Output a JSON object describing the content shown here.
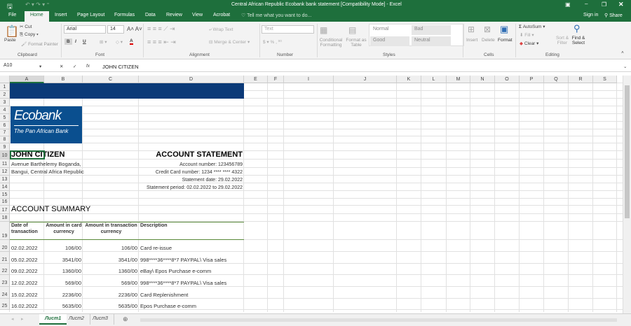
{
  "window": {
    "title": "Central African Republic Ecobank bank statement  [Compatibility Mode] - Excel",
    "sign_in": "Sign in",
    "share": "Share"
  },
  "ribbon_tabs": [
    "File",
    "Home",
    "Insert",
    "Page Layout",
    "Formulas",
    "Data",
    "Review",
    "View",
    "Acrobat"
  ],
  "tell_me": "Tell me what you want to do...",
  "ribbon": {
    "clipboard": {
      "paste": "Paste",
      "cut": "Cut",
      "copy": "Copy",
      "format_painter": "Format Painter",
      "group": "Clipboard"
    },
    "font": {
      "name": "Arial",
      "size": "14",
      "bold": "B",
      "italic": "I",
      "underline": "U",
      "group": "Font"
    },
    "alignment": {
      "wrap": "Wrap Text",
      "merge": "Merge & Center",
      "group": "Alignment"
    },
    "number": {
      "format": "Text",
      "group": "Number"
    },
    "styles": {
      "conditional": "Conditional Formatting",
      "format_table": "Format as Table",
      "normal": "Normal",
      "bad": "Bad",
      "good": "Good",
      "neutral": "Neutral",
      "group": "Styles"
    },
    "cells": {
      "insert": "Insert",
      "delete": "Delete",
      "format": "Format",
      "group": "Cells"
    },
    "editing": {
      "autosum": "AutoSum",
      "fill": "Fill",
      "clear": "Clear",
      "sort": "Sort & Filter",
      "find": "Find & Select",
      "group": "Editing"
    }
  },
  "formula_bar": {
    "name_box": "A10",
    "cancel": "✕",
    "enter": "✓",
    "fx": "fx",
    "value": "JOHN CITIZEN"
  },
  "columns": [
    "A",
    "B",
    "C",
    "D",
    "E",
    "F",
    "I",
    "J",
    "K",
    "L",
    "M",
    "N",
    "O",
    "P",
    "Q",
    "R",
    "S"
  ],
  "rows": [
    "1",
    "2",
    "3",
    "4",
    "5",
    "6",
    "7",
    "8",
    "9",
    "10",
    "11",
    "12",
    "13",
    "14",
    "15",
    "16",
    "17",
    "18",
    "19",
    "20",
    "21",
    "22",
    "23",
    "24",
    "25"
  ],
  "logo": {
    "brand": "Ecobank",
    "tagline": "The Pan African Bank"
  },
  "sheet": {
    "name": "JOHN CITIZEN",
    "address1": "Avenue Barthelemy Boganda,",
    "address2": "Bangui, Central Africa Republic",
    "heading": "ACCOUNT STATEMENT",
    "account_number": "Account number: 123456789",
    "card_number": "Credit Card number: 1234 **** **** 4322",
    "statement_date": "Statement date: 29.02.2022",
    "statement_period": "Statement period: 02.02.2022 to 29.02.2022",
    "summary_title": "ACCOUNT SUMMARY",
    "table_headers": [
      "Date of transaction",
      "Amount in card currency",
      "Amount in transaction currency",
      "Description"
    ],
    "transactions": [
      [
        "02.02.2022",
        "106/00",
        "106/00",
        "Card re-issue"
      ],
      [
        "05.02.2022",
        "3541/00",
        "3541/00",
        "998****36****8*7 PAYPAL\\ Visa sales"
      ],
      [
        "09.02.2022",
        "1360/00",
        "1360/00",
        "eBay\\ Epos Purchase e-comm"
      ],
      [
        "12.02.2022",
        "569/00",
        "569/00",
        "998****36****8*7 PAYPAL\\ Visa sales"
      ],
      [
        "15.02.2022",
        "2236/00",
        "2236/00",
        "Card Replenishment"
      ],
      [
        "16.02.2022",
        "5635/00",
        "5635/00",
        "Epos Purchase e-comm"
      ]
    ]
  },
  "sheet_tabs": [
    "Лист1",
    "Лист2",
    "Лист3"
  ],
  "colors": {
    "excel_green": "#1e6f3c",
    "banner_blue": "#0b3a78",
    "table_rule": "#5a8a3a"
  }
}
